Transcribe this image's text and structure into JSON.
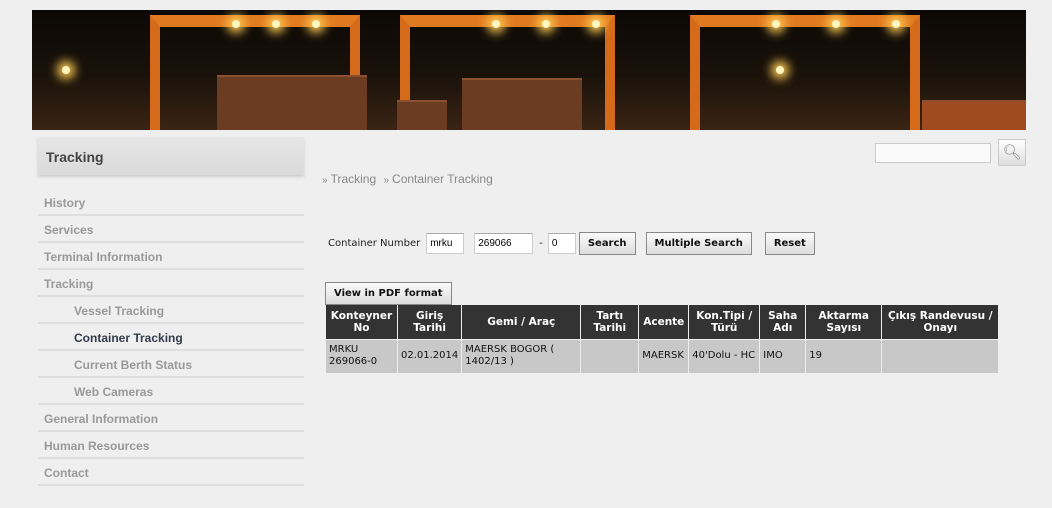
{
  "sidebar": {
    "title": "Tracking",
    "items": [
      {
        "label": "History",
        "sub": false
      },
      {
        "label": "Services",
        "sub": false
      },
      {
        "label": "Terminal Information",
        "sub": false
      },
      {
        "label": "Tracking",
        "sub": false
      },
      {
        "label": "Vessel Tracking",
        "sub": true
      },
      {
        "label": "Container Tracking",
        "sub": true,
        "active": true
      },
      {
        "label": "Current Berth Status",
        "sub": true
      },
      {
        "label": "Web Cameras",
        "sub": true
      },
      {
        "label": "General Information",
        "sub": false
      },
      {
        "label": "Human Resources",
        "sub": false
      },
      {
        "label": "Contact",
        "sub": false
      }
    ]
  },
  "search": {
    "value": "",
    "icon": "magnifier-icon"
  },
  "breadcrumb": {
    "sep": "»",
    "items": [
      "Tracking",
      "Container Tracking"
    ]
  },
  "form": {
    "label": "Container Number",
    "prefix": "mrku",
    "number": "269066",
    "dash": "-",
    "check": "0",
    "search": "Search",
    "multiple": "Multiple Search",
    "reset": "Reset"
  },
  "pdf_button": "View in PDF format",
  "table": {
    "headers": [
      "Konteyner No",
      "Giriş Tarihi",
      "Gemi / Araç",
      "Tartı Tarihi",
      "Acente",
      "Kon.Tipi / Türü",
      "Saha Adı",
      "Aktarma Sayısı",
      "Çıkış Randevusu / Onayı"
    ],
    "rows": [
      [
        "MRKU 269066-0",
        "02.01.2014",
        "MAERSK BOGOR ( 1402/13 )",
        "",
        "MAERSK",
        "40'Dolu - HC",
        "IMO",
        "19",
        ""
      ]
    ]
  }
}
